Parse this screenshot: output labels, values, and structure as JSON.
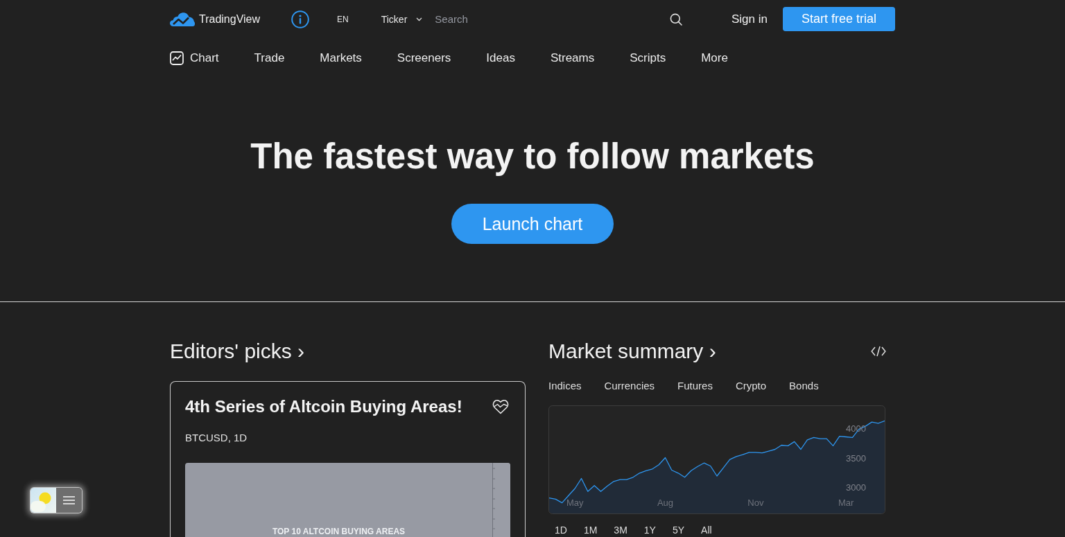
{
  "header": {
    "logo_text": "TradingView",
    "language": "EN",
    "ticker": "Ticker",
    "search": {
      "placeholder": "Search"
    },
    "sign_in": "Sign in",
    "trial_button": "Start free trial"
  },
  "nav": {
    "items": [
      {
        "kind": "icon_link",
        "label": "Chart"
      },
      {
        "kind": "link",
        "label": "Trade"
      },
      {
        "kind": "link",
        "label": "Markets"
      },
      {
        "kind": "link",
        "label": "Screeners"
      },
      {
        "kind": "link",
        "label": "Ideas"
      },
      {
        "kind": "link",
        "label": "Streams"
      },
      {
        "kind": "link",
        "label": "Scripts"
      },
      {
        "kind": "link",
        "label": "More"
      }
    ]
  },
  "hero": {
    "title": "The fastest way to follow markets",
    "button": "Launch chart"
  },
  "editors_picks": {
    "title": "Editors' picks ›",
    "card": {
      "title": "4th Series of Altcoin Buying Areas!",
      "symbol": "BTCUSD, 1D",
      "snapshot_caption": "TOP 10 ALTCOIN BUYING AREAS"
    }
  },
  "market_summary": {
    "title": "Market summary ›",
    "tabs": [
      "Indices",
      "Currencies",
      "Futures",
      "Crypto",
      "Bonds"
    ],
    "chart_data": {
      "type": "area",
      "categories": [
        null,
        null,
        null,
        null,
        "May",
        null,
        null,
        null,
        null,
        null,
        null,
        null,
        null,
        null,
        null,
        null,
        null,
        null,
        "Aug",
        null,
        null,
        null,
        null,
        null,
        null,
        null,
        null,
        null,
        null,
        null,
        null,
        null,
        "Nov",
        null,
        null,
        null,
        null,
        null,
        null,
        null,
        null,
        null,
        null,
        null,
        null,
        null,
        "Mar",
        null,
        null,
        null,
        null,
        null,
        null
      ],
      "values": [
        2820,
        2800,
        2740,
        2860,
        2980,
        3150,
        2930,
        3030,
        2930,
        3020,
        3100,
        3130,
        3130,
        3170,
        3240,
        3280,
        3310,
        3380,
        3500,
        3290,
        3240,
        3170,
        3280,
        3350,
        3410,
        3360,
        3190,
        3330,
        3470,
        3520,
        3550,
        3590,
        3590,
        3580,
        3610,
        3640,
        3710,
        3700,
        3770,
        3640,
        3800,
        3840,
        3820,
        3820,
        3700,
        3860,
        3850,
        3840,
        3980,
        4030,
        4100,
        4080,
        4120
      ],
      "ylim": [
        2560,
        4370
      ],
      "yticks": [
        3000,
        3500,
        4000
      ]
    },
    "ranges": [
      "1D",
      "1M",
      "3M",
      "1Y",
      "5Y",
      "All"
    ]
  }
}
